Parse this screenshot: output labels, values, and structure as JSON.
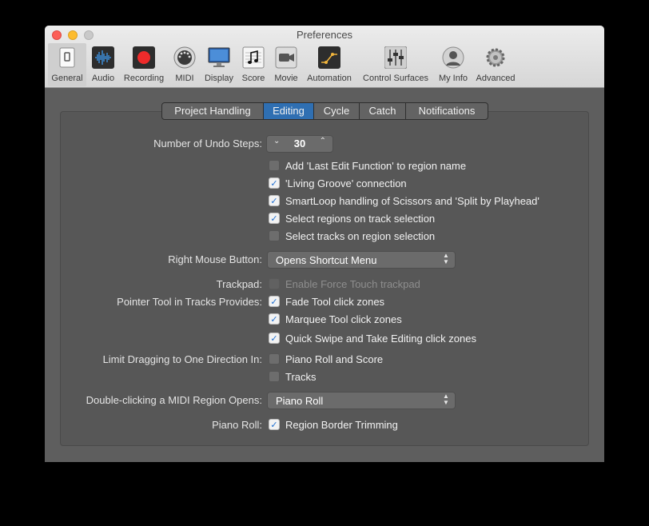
{
  "window": {
    "title": "Preferences"
  },
  "toolbar": {
    "items": [
      {
        "label": "General",
        "icon": "general-icon",
        "selected": true
      },
      {
        "label": "Audio",
        "icon": "audio-waveform-icon"
      },
      {
        "label": "Recording",
        "icon": "record-icon"
      },
      {
        "label": "MIDI",
        "icon": "midi-connector-icon"
      },
      {
        "label": "Display",
        "icon": "display-monitor-icon"
      },
      {
        "label": "Score",
        "icon": "score-notes-icon"
      },
      {
        "label": "Movie",
        "icon": "movie-camera-icon"
      },
      {
        "label": "Automation",
        "icon": "automation-curve-icon"
      },
      {
        "label": "Control Surfaces",
        "icon": "faders-icon"
      },
      {
        "label": "My Info",
        "icon": "user-avatar-icon"
      },
      {
        "label": "Advanced",
        "icon": "gear-icon"
      }
    ]
  },
  "tabs": [
    {
      "label": "Project Handling"
    },
    {
      "label": "Editing",
      "active": true
    },
    {
      "label": "Cycle"
    },
    {
      "label": "Catch"
    },
    {
      "label": "Notifications"
    }
  ],
  "settings": {
    "undo_label": "Number of Undo Steps:",
    "undo_value": "30",
    "undo_down": "⌄",
    "undo_up": "⌃",
    "options": [
      {
        "label": "Add 'Last Edit Function' to region name",
        "checked": false
      },
      {
        "label": "'Living Groove' connection",
        "checked": true
      },
      {
        "label": "SmartLoop handling of Scissors and 'Split by Playhead'",
        "checked": true
      },
      {
        "label": "Select regions on track selection",
        "checked": true
      },
      {
        "label": "Select tracks on region selection",
        "checked": false
      }
    ],
    "right_mouse_label": "Right Mouse Button:",
    "right_mouse_value": "Opens Shortcut Menu",
    "trackpad_label": "Trackpad:",
    "trackpad_option": {
      "label": "Enable Force Touch trackpad",
      "checked": false,
      "disabled": true
    },
    "pointer_label": "Pointer Tool in Tracks Provides:",
    "pointer_options": [
      {
        "label": "Fade Tool click zones",
        "checked": true
      },
      {
        "label": "Marquee Tool click zones",
        "checked": true
      },
      {
        "label": "Quick Swipe and Take Editing click zones",
        "checked": true
      }
    ],
    "limit_label": "Limit Dragging to One Direction In:",
    "limit_options": [
      {
        "label": "Piano Roll and Score",
        "checked": false
      },
      {
        "label": "Tracks",
        "checked": false
      }
    ],
    "double_click_label": "Double-clicking a MIDI Region Opens:",
    "double_click_value": "Piano Roll",
    "piano_roll_label": "Piano Roll:",
    "piano_roll_option": {
      "label": "Region Border Trimming",
      "checked": true
    }
  },
  "colors": {
    "accent": "#2f6fb2",
    "window_bg": "#5e5e5e",
    "checkmark": "#1e6fd1"
  }
}
